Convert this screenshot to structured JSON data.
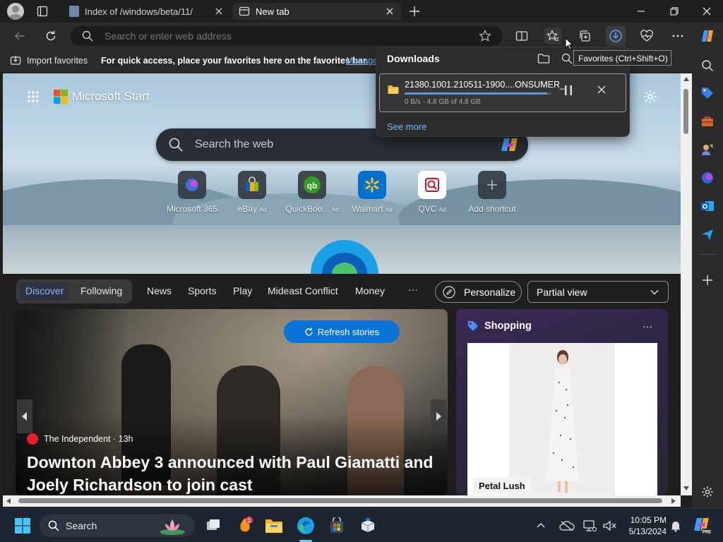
{
  "browser": {
    "tabs": [
      {
        "label": "Index of /windows/beta/11/",
        "icon": "page-icon",
        "active": false
      },
      {
        "label": "New tab",
        "icon": "newtab-icon",
        "active": true
      }
    ],
    "window_controls": {
      "minimize": "minimize-icon",
      "maximize": "restore-icon",
      "close": "close-icon"
    }
  },
  "addressbar": {
    "placeholder": "Search or enter web address"
  },
  "tooltip": "Favorites (Ctrl+Shift+O)",
  "favorites_bar": {
    "import_label": "Import favorites",
    "hint": "For quick access, place your favorites here on the favorites bar.",
    "manage_link": "Manage"
  },
  "downloads": {
    "title": "Downloads",
    "item": {
      "filename": "21380.1001.210511-1900....ONSUMER_",
      "status": "0 B/s - 4.8 GB of 4.8 GB",
      "progress_fraction": 0.97
    },
    "see_more": "See more"
  },
  "newtab": {
    "brand": "Microsoft Start",
    "search_placeholder": "Search the web",
    "tiles": [
      {
        "label": "Microsoft 365",
        "ad": "",
        "icon": "m365-icon"
      },
      {
        "label": "eBay",
        "ad": "Ad",
        "icon": "ebay-icon"
      },
      {
        "label": "QuickBoo...",
        "ad": "Ad",
        "icon": "quickbooks-icon"
      },
      {
        "label": "Walmart",
        "ad": "Ad",
        "icon": "walmart-icon"
      },
      {
        "label": "QVC",
        "ad": "Ad",
        "icon": "qvc-icon"
      },
      {
        "label": "Add shortcut",
        "ad": "",
        "icon": "plus-icon"
      }
    ],
    "feed_nav": {
      "discover": "Discover",
      "following": "Following",
      "items": [
        "News",
        "Sports",
        "Play",
        "Mideast Conflict",
        "Money"
      ],
      "more": "···",
      "personalize": "Personalize",
      "view_select": "Partial view"
    },
    "story": {
      "refresh": "Refresh stories",
      "source": "The Independent · 13h",
      "headline": "Downton Abbey 3 announced with Paul Giamatti and Joely Richardson to join cast"
    },
    "shopping": {
      "title": "Shopping",
      "more": "···",
      "product_tag": "Petal Lush"
    }
  },
  "taskbar": {
    "search_label": "Search",
    "time": "10:05 PM",
    "date": "5/13/2024",
    "notification_badge": "1"
  },
  "colors": {
    "accent_blue": "#0a74d8",
    "link_blue": "#7ab8ff",
    "progress_blue": "#5b9bd5"
  }
}
